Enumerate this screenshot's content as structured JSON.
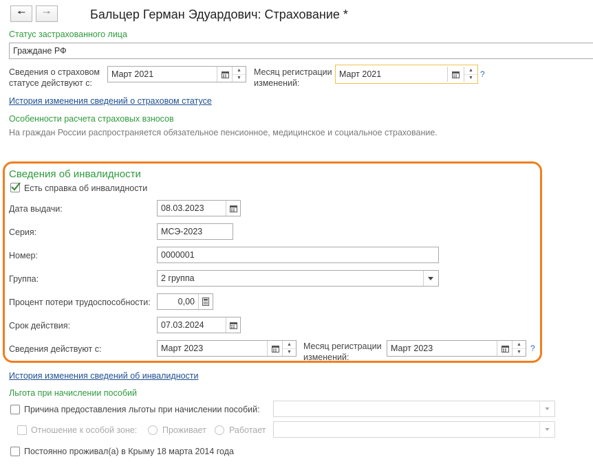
{
  "window": {
    "title": "Бальцер Герман Эдуардович: Страхование *"
  },
  "nav": {
    "back_icon": "arrow-left-icon",
    "forward_icon": "arrow-right-icon"
  },
  "status": {
    "section_label": "Статус застрахованного лица",
    "value": "Граждане РФ",
    "effective_label_1": "Сведения о страховом",
    "effective_label_2": "статусе действуют с:",
    "effective_value": "Март 2021",
    "reg_month_label_1": "Месяц регистрации",
    "reg_month_label_2": "изменений:",
    "reg_month_value": "Март 2021",
    "history_link": "История изменения сведений о страховом статусе",
    "help": "?"
  },
  "contributions": {
    "section_label": "Особенности расчета страховых взносов",
    "note": "На граждан России распространяется обязательное пенсионное, медицинское и социальное страхование."
  },
  "disability": {
    "section_label": "Сведения об инвалидности",
    "has_certificate_label": "Есть справка об инвалидности",
    "has_certificate": true,
    "issue_date_label": "Дата выдачи:",
    "issue_date": "08.03.2023",
    "series_label": "Серия:",
    "series": "МСЭ-2023",
    "number_label": "Номер:",
    "number": "0000001",
    "group_label": "Группа:",
    "group": "2 группа",
    "loss_label": "Процент потери трудоспособности:",
    "loss": "0,00",
    "validity_label": "Срок действия:",
    "validity": "07.03.2024",
    "effective_label": "Сведения действуют с:",
    "effective_value": "Март 2023",
    "reg_month_label_1": "Месяц регистрации",
    "reg_month_label_2": "изменений:",
    "reg_month_value": "Март 2023",
    "help": "?",
    "history_link": "История изменения сведений об инвалидности"
  },
  "benefits": {
    "section_label": "Льгота при начислении пособий",
    "reason_label": "Причина предоставления льготы при начислении пособий:",
    "reason_value": "",
    "zone_label": "Отношение к особой зоне:",
    "zone_option_1": "Проживает",
    "zone_option_2": "Работает",
    "zone_value": "",
    "crimea_label": "Постоянно проживал(а) в Крыму 18 марта 2014 года"
  },
  "colors": {
    "accent_green": "#2e9a3c",
    "link_blue": "#1d4f91",
    "highlight_orange": "#f07e1e",
    "focus_yellow": "#f0c24a"
  }
}
